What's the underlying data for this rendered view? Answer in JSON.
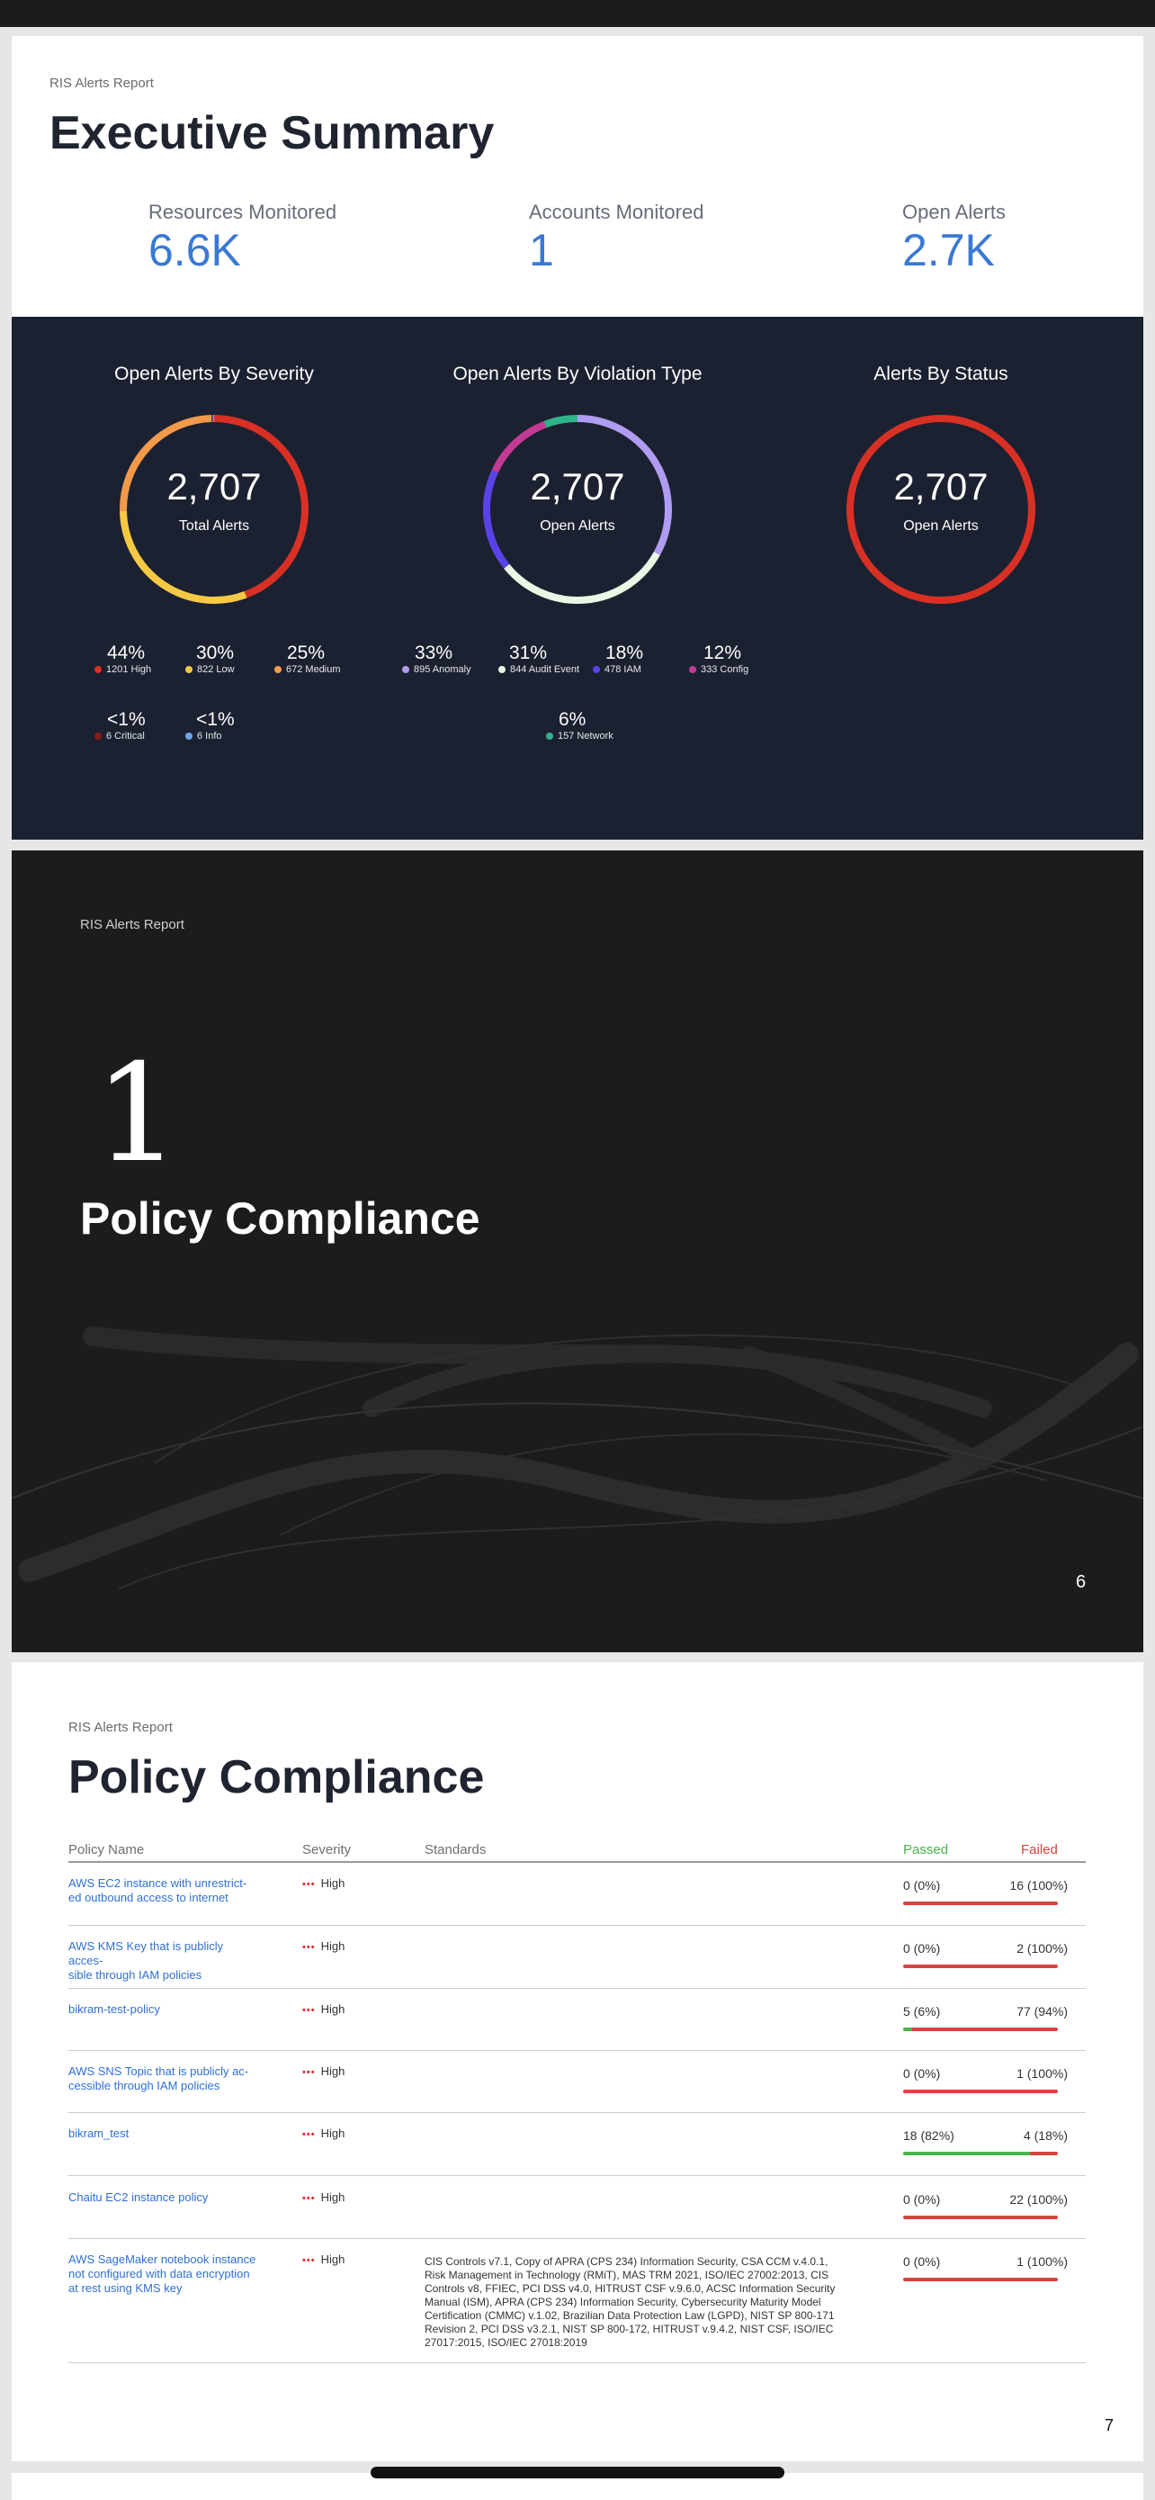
{
  "report_label": "RIS Alerts Report",
  "summary": {
    "title": "Executive Summary",
    "metrics": [
      {
        "label": "Resources Monitored",
        "value": "6.6K"
      },
      {
        "label": "Accounts Monitored",
        "value": "1"
      },
      {
        "label": "Open Alerts",
        "value": "2.7K"
      }
    ]
  },
  "chart_data": [
    {
      "type": "pie",
      "title": "Open Alerts By Severity",
      "center_value": "2,707",
      "center_label": "Total Alerts",
      "slices": [
        {
          "pct": "44%",
          "label": "1201 High",
          "value": 1201,
          "color": "#d93025"
        },
        {
          "pct": "30%",
          "label": "822 Low",
          "value": 822,
          "color": "#f6c945"
        },
        {
          "pct": "25%",
          "label": "672 Medium",
          "value": 672,
          "color": "#f39a4a"
        },
        {
          "pct": "<1%",
          "label": "6 Critical",
          "value": 6,
          "color": "#8b1a1a"
        },
        {
          "pct": "<1%",
          "label": "6 Info",
          "value": 6,
          "color": "#6ea5e8"
        }
      ]
    },
    {
      "type": "pie",
      "title": "Open Alerts By Violation Type",
      "center_value": "2,707",
      "center_label": "Open Alerts",
      "slices": [
        {
          "pct": "33%",
          "label": "895 Anomaly",
          "value": 895,
          "color": "#b19cf3"
        },
        {
          "pct": "31%",
          "label": "844 Audit Event",
          "value": 844,
          "color": "#e8f8e4"
        },
        {
          "pct": "18%",
          "label": "478 IAM",
          "value": 478,
          "color": "#5a43e6"
        },
        {
          "pct": "12%",
          "label": "333 Config",
          "value": 333,
          "color": "#c23a93"
        },
        {
          "pct": "6%",
          "label": "157 Network",
          "value": 157,
          "color": "#2fb38a"
        }
      ]
    },
    {
      "type": "pie",
      "title": "Alerts By Status",
      "center_value": "2,707",
      "center_label": "Open Alerts",
      "slices": [
        {
          "value": 2707,
          "color": "#d93025"
        }
      ]
    }
  ],
  "section": {
    "number": "1",
    "title": "Policy Compliance",
    "page_number": "6"
  },
  "compliance": {
    "title": "Policy Compliance",
    "page_number": "7",
    "headers": {
      "policy": "Policy Name",
      "severity": "Severity",
      "standards": "Standards",
      "passed": "Passed",
      "failed": "Failed"
    },
    "header_colors": {
      "passed": "#4cb34b",
      "failed": "#d6453f"
    },
    "rows": [
      {
        "name": [
          "AWS EC2 instance with unrestrict-",
          "ed outbound access to internet"
        ],
        "severity": "High",
        "standards": [],
        "passed": "0 (0%)",
        "failed": "16 (100%)",
        "pass_fraction": 0
      },
      {
        "name": [
          "AWS KMS Key that is publicly acces-",
          "sible through IAM policies"
        ],
        "severity": "High",
        "standards": [],
        "passed": "0 (0%)",
        "failed": "2 (100%)",
        "pass_fraction": 0
      },
      {
        "name": [
          "bikram-test-policy"
        ],
        "severity": "High",
        "standards": [],
        "passed": "5 (6%)",
        "failed": "77 (94%)",
        "pass_fraction": 0.06
      },
      {
        "name": [
          "AWS SNS Topic that is publicly ac-",
          "cessible through IAM policies"
        ],
        "severity": "High",
        "standards": [],
        "passed": "0 (0%)",
        "failed": "1 (100%)",
        "pass_fraction": 0
      },
      {
        "name": [
          "bikram_test"
        ],
        "severity": "High",
        "standards": [],
        "passed": "18 (82%)",
        "failed": "4 (18%)",
        "pass_fraction": 0.82
      },
      {
        "name": [
          "Chaitu EC2 instance policy"
        ],
        "severity": "High",
        "standards": [],
        "passed": "0 (0%)",
        "failed": "22 (100%)",
        "pass_fraction": 0
      },
      {
        "name": [
          "AWS SageMaker notebook instance",
          "not configured with data encryption",
          "at rest using KMS key"
        ],
        "severity": "High",
        "standards": [
          "CIS Controls v7.1, Copy of APRA (CPS 234) Information Security, CSA CCM v.4.0.1,",
          "Risk Management in Technology (RMiT), MAS TRM 2021, ISO/IEC 27002:2013, CIS",
          "Controls v8, FFIEC, PCI DSS v4.0, HITRUST CSF v.9.6.0, ACSC Information Security",
          "Manual (ISM), APRA (CPS 234) Information Security, Cybersecurity Maturity Model",
          "Certification (CMMC) v.1.02, Brazilian Data Protection Law (LGPD), NIST SP 800-171",
          "Revision 2, PCI DSS v3.2.1, NIST SP 800-172, HITRUST v.9.4.2, NIST CSF, ISO/IEC",
          "27017:2015, ISO/IEC 27018:2019"
        ],
        "passed": "0 (0%)",
        "failed": "1 (100%)",
        "pass_fraction": 0
      }
    ]
  }
}
